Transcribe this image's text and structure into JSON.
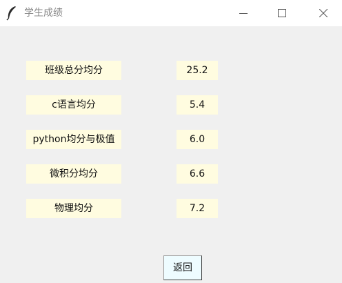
{
  "window": {
    "title": "学生成绩",
    "icon": "feather-icon"
  },
  "stats": [
    {
      "label": "班级总分均分",
      "value": "25.2"
    },
    {
      "label": "c语言均分",
      "value": "5.4"
    },
    {
      "label": "python均分与极值",
      "value": "6.0"
    },
    {
      "label": "微积分均分",
      "value": "6.6"
    },
    {
      "label": "物理均分",
      "value": "7.2"
    }
  ],
  "actions": {
    "back_label": "返回"
  },
  "colors": {
    "label_bg": "#fffce0",
    "button_bg": "#eefcff",
    "window_bg": "#f0f0f0"
  }
}
